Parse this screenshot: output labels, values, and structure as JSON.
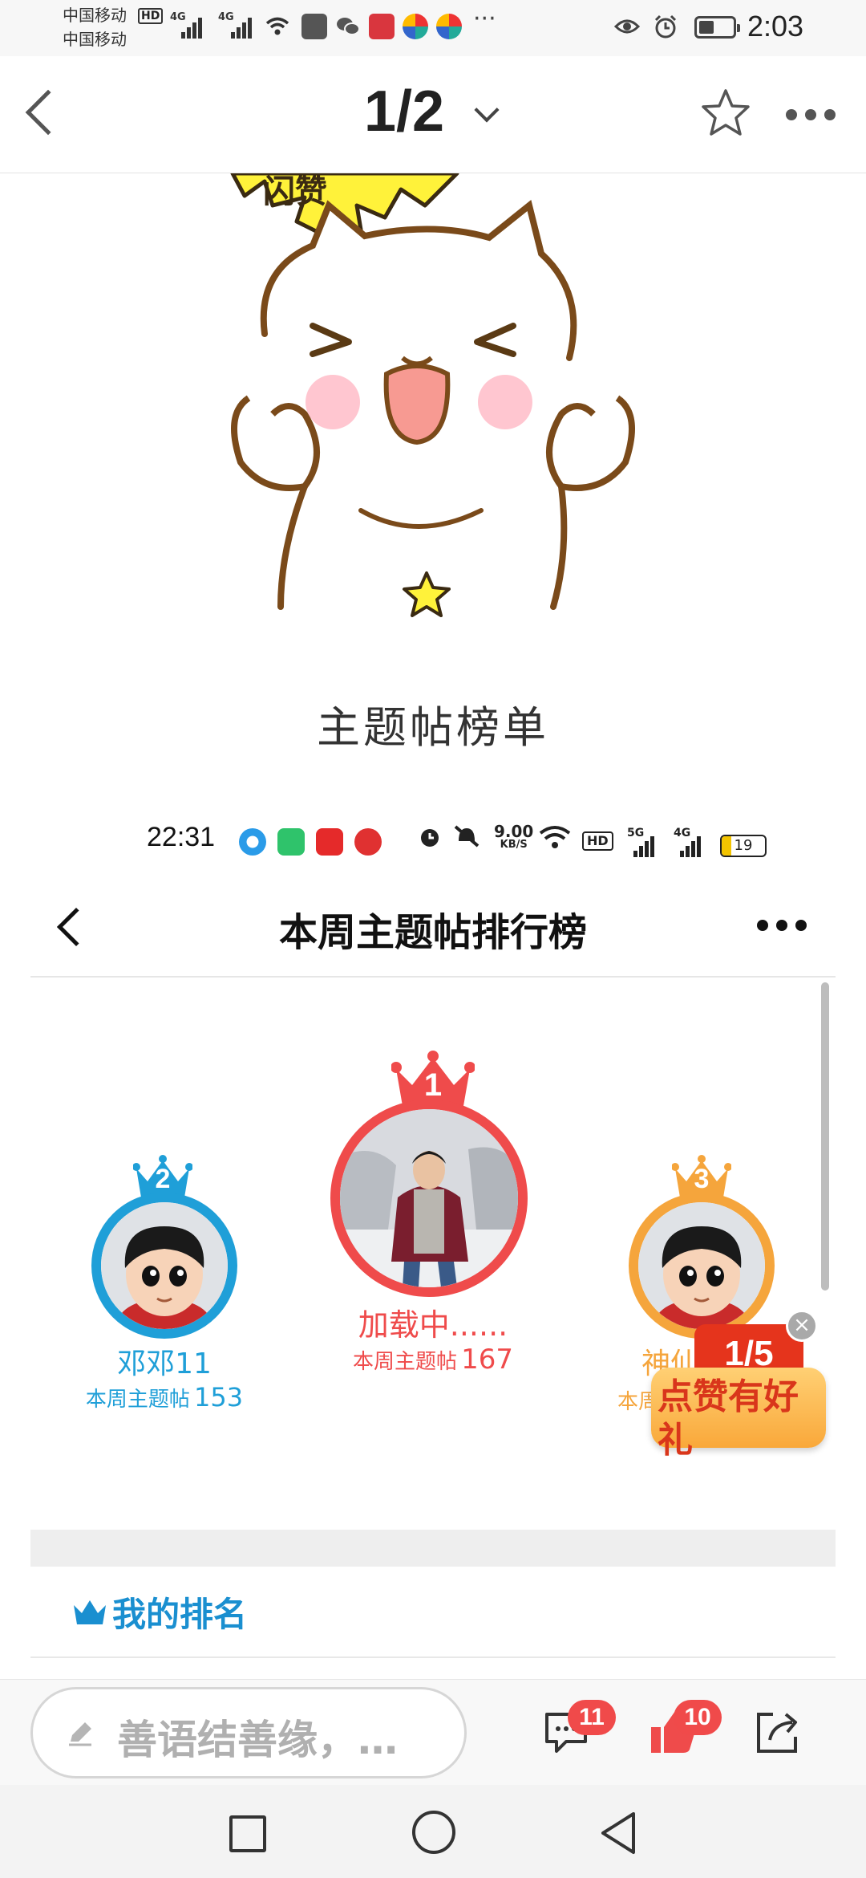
{
  "status_bar": {
    "carrier_1": "中国移动",
    "carrier_2": "中国移动",
    "hd": "HD",
    "net_1": "4G",
    "net_2": "4G",
    "time": "2:03",
    "more": "···"
  },
  "header": {
    "page_indicator": "1/2"
  },
  "sticker": {
    "banner_text": "闪赞"
  },
  "thread_title": "主题帖榜单",
  "embedded": {
    "status_bar": {
      "time": "22:31",
      "speed": "9.00",
      "speed_unit": "KB/S",
      "hd": "HD",
      "net_1": "5G",
      "net_2": "4G",
      "battery": "19"
    },
    "title": "本周主题帖排行榜",
    "podium": [
      {
        "rank": "2",
        "name": "邓邓11",
        "count_label": "本周主题帖",
        "count": "153",
        "color": "#1f9fd8"
      },
      {
        "rank": "1",
        "name": "加载中......",
        "count_label": "本周主题帖",
        "count": "167",
        "color": "#ef4b4b"
      },
      {
        "rank": "3",
        "name": "神仙",
        "count_label": "本周",
        "count": "",
        "color": "#f5a53c"
      }
    ],
    "promo": {
      "page": "1/5",
      "text": "点赞有好礼",
      "close": "×"
    },
    "my_rank": "我的排名"
  },
  "bottom": {
    "placeholder": "善语结善缘，…",
    "comment_count": "11",
    "like_count": "10"
  },
  "colors": {
    "accent_blue": "#1a8fd0",
    "rank1_red": "#ef4b4b",
    "rank2_blue": "#1f9fd8",
    "rank3_orange": "#f5a53c",
    "badge_red": "#f04a4a"
  }
}
